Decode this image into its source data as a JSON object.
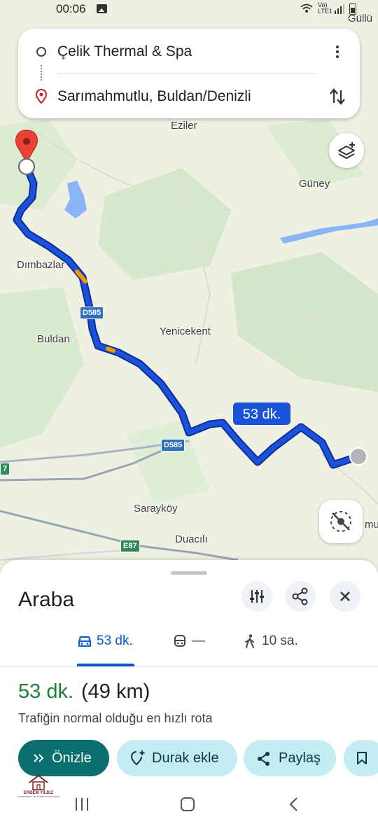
{
  "status_bar": {
    "time": "00:06",
    "network_line1": "Vo)",
    "network_line2": "LTE1",
    "icons": [
      "gallery-icon",
      "wifi-icon",
      "signal-icon",
      "battery-icon"
    ]
  },
  "route": {
    "origin": "Çelik Thermal & Spa",
    "destination": "Sarımahmutlu, Buldan/Denizli",
    "more_icon": "more-vert-icon",
    "swap_icon": "swap-vert-icon"
  },
  "map": {
    "place_labels": {
      "gullu": "Güllü",
      "eziler": "Eziler",
      "guney": "Güney",
      "dimbazlar": "Dımbazlar",
      "buldan": "Buldan",
      "yenicekent": "Yenicekent",
      "saraykoy": "Sarayköy",
      "duacili": "Duacılı",
      "edge_mu": "mu",
      "edge_7": "7"
    },
    "road_shields": {
      "d585_north": "D585",
      "d585_south": "D585",
      "e87": "E87"
    },
    "duration_bubble": "53 dk.",
    "route_color": "#1a53d7",
    "traffic_color": "#f29900"
  },
  "sheet": {
    "title": "Araba",
    "modes": {
      "car": {
        "icon": "car-icon",
        "label": "53 dk.",
        "selected": true
      },
      "transit": {
        "icon": "train-icon",
        "label": "—"
      },
      "walk": {
        "icon": "walk-icon",
        "label": "10 sa."
      }
    },
    "summary_time": "53 dk.",
    "summary_distance": "(49 km)",
    "summary_description": "Trafiğin normal olduğu en hızlı rota",
    "chips": {
      "preview": "Önizle",
      "add_stop": "Durak ekle",
      "share": "Paylaş"
    },
    "accent": "#0b57d0",
    "time_color": "#188038"
  },
  "watermark": {
    "name": "ERDEM YILDIZ",
    "subtitle": "GAYRİMENKUL VE YATIRIM DANIŞMANLIĞI"
  }
}
